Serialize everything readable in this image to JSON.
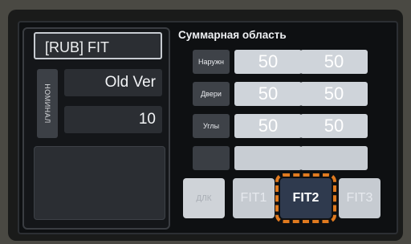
{
  "left_panel": {
    "title": "[RUB] FIT",
    "vertical_label": "НОМИНАЛ",
    "value1": "Old Ver",
    "value2": "10"
  },
  "right_panel": {
    "title": "Суммарная область",
    "rows": [
      {
        "label": "Наружн",
        "col1": "50",
        "col2": "50"
      },
      {
        "label": "Двери",
        "col1": "50",
        "col2": "50"
      },
      {
        "label": "Углы",
        "col1": "50",
        "col2": "50"
      },
      {
        "label": "",
        "col1": "",
        "col2": ""
      }
    ]
  },
  "buttons": {
    "small": "ДЛК",
    "fit1": "FIT1",
    "fit2": "FIT2",
    "fit3": "FIT3"
  },
  "colors": {
    "highlight": "#e07a1f",
    "selected_button": "#2f3a4e"
  }
}
